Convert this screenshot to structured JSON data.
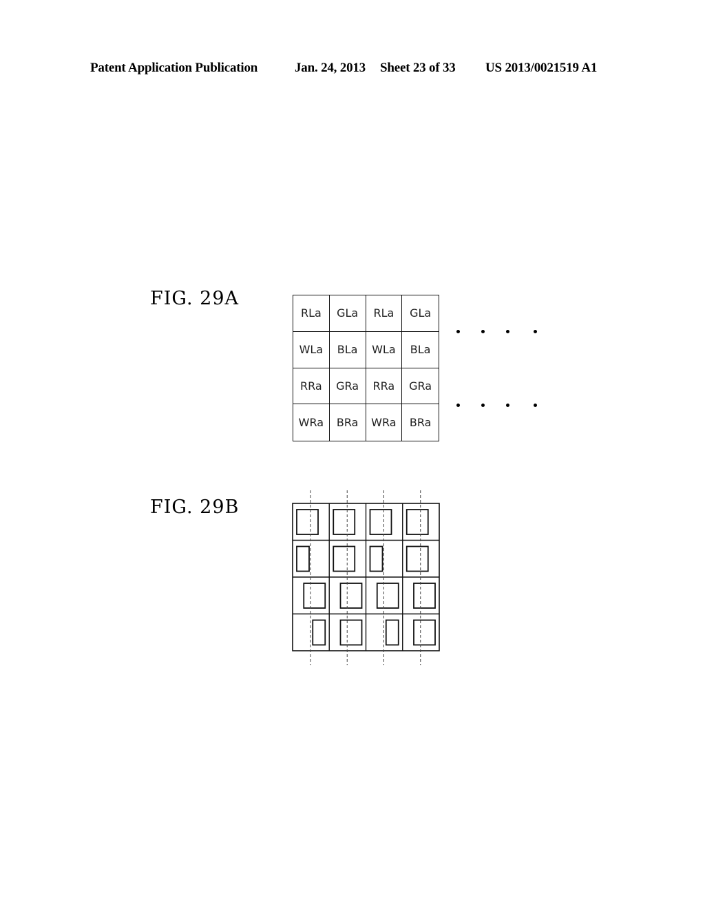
{
  "header": {
    "publication": "Patent Application Publication",
    "date": "Jan. 24, 2013",
    "sheet": "Sheet 23 of 33",
    "number": "US 2013/0021519 A1"
  },
  "fig_a": {
    "label": "FIG.  29A",
    "cells": [
      "RLa",
      "GLa",
      "RLa",
      "GLa",
      "WLa",
      "BLa",
      "WLa",
      "BLa",
      "RRa",
      "GRa",
      "RRa",
      "GRa",
      "WRa",
      "BRa",
      "WRa",
      "BRa"
    ],
    "continuation_rows": 2,
    "continuation_dots_per_row": 4
  },
  "fig_b": {
    "label": "FIG.  29B",
    "rows": 4,
    "cols": 4,
    "apertures": [
      [
        "full-left",
        "full-left",
        "full-left",
        "full-left"
      ],
      [
        "narrow-left",
        "full-left",
        "narrow-left",
        "full-left"
      ],
      [
        "full-right",
        "full-right",
        "full-right",
        "full-right"
      ],
      [
        "narrow-right",
        "full-right",
        "narrow-right",
        "full-right"
      ]
    ],
    "center_lines": "dashed"
  }
}
